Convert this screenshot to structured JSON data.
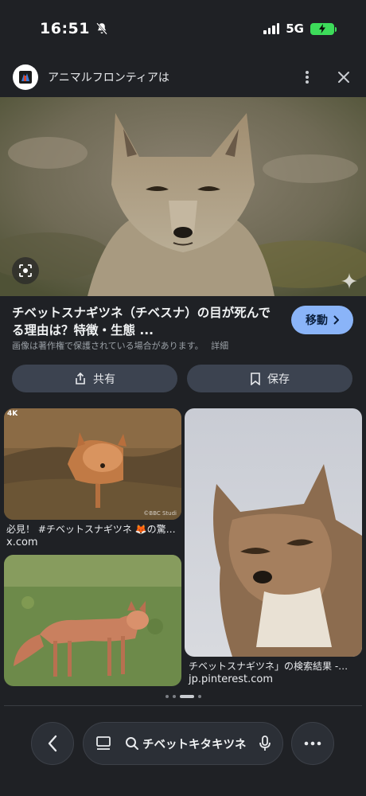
{
  "status_bar": {
    "time": "16:51",
    "network": "5G",
    "icons": [
      "bell-off-icon",
      "signal-icon",
      "battery-charging-icon"
    ]
  },
  "source": {
    "title": "アニマルフロンティアは",
    "logo": "site-logo-icon"
  },
  "result": {
    "title": "チベットスナギツネ（チベスナ）の目が死んでる理由は？特徴・生態 ...",
    "copyright": "画像は著作権で保護されている場合があります。",
    "details_label": "詳細",
    "visit_label": "移動"
  },
  "actions": {
    "share_label": "共有",
    "save_label": "保存"
  },
  "related": [
    {
      "caption": "必見！ #チベットスナギツネ 🦊の驚…",
      "domain": "x.com",
      "watermark": "©BBC Studi",
      "badge": "4K"
    },
    {
      "caption": "チベットスナギツネ」の検索結果 -…",
      "domain": "jp.pinterest.com"
    },
    {
      "caption": "",
      "domain": ""
    }
  ],
  "bottom_bar": {
    "search_query": "チベットキタキツネ"
  },
  "colors": {
    "background": "#1f2125",
    "accent": "#8ab4f8",
    "button": "#3c4350",
    "battery": "#3ddc5a"
  }
}
